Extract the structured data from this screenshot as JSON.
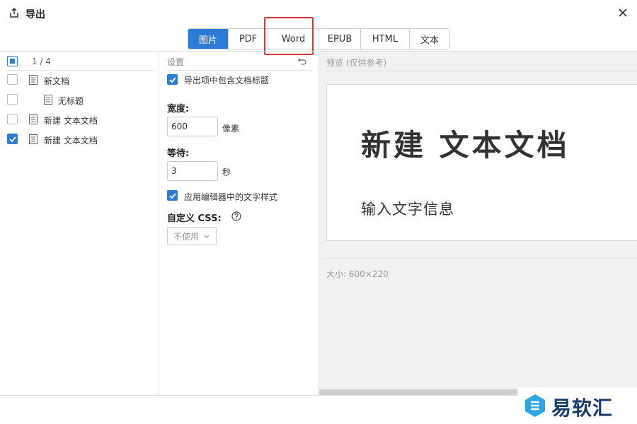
{
  "header": {
    "title": "导出"
  },
  "tabs": [
    {
      "label": "图片",
      "active": true
    },
    {
      "label": "PDF",
      "active": false
    },
    {
      "label": "Word",
      "active": false
    },
    {
      "label": "EPUB",
      "active": false
    },
    {
      "label": "HTML",
      "active": false
    },
    {
      "label": "文本",
      "active": false
    }
  ],
  "doc_list": {
    "count": "1 / 4",
    "items": [
      {
        "label": "新文档",
        "checked": false
      },
      {
        "label": "无标题",
        "checked": false
      },
      {
        "label": "新建 文本文档",
        "checked": false
      },
      {
        "label": "新建 文本文档",
        "checked": true
      }
    ]
  },
  "settings": {
    "title": "设置",
    "include_title_label": "导出项中包含文档标题",
    "width_label": "宽度:",
    "width_value": "600",
    "width_unit": "像素",
    "wait_label": "等待:",
    "wait_value": "3",
    "wait_unit": "秒",
    "use_editor_style_label": "应用编辑器中的文字样式",
    "custom_css_label": "自定义 CSS:",
    "custom_css_value": "不使用"
  },
  "preview": {
    "title": "预览 (仅供参考)",
    "heading": "新建 文本文档",
    "body": "输入文字信息",
    "size": "大小: 600×220"
  },
  "watermark": {
    "text": "易软汇"
  },
  "colors": {
    "accent": "#2e7bd6",
    "highlight": "#e03535"
  }
}
